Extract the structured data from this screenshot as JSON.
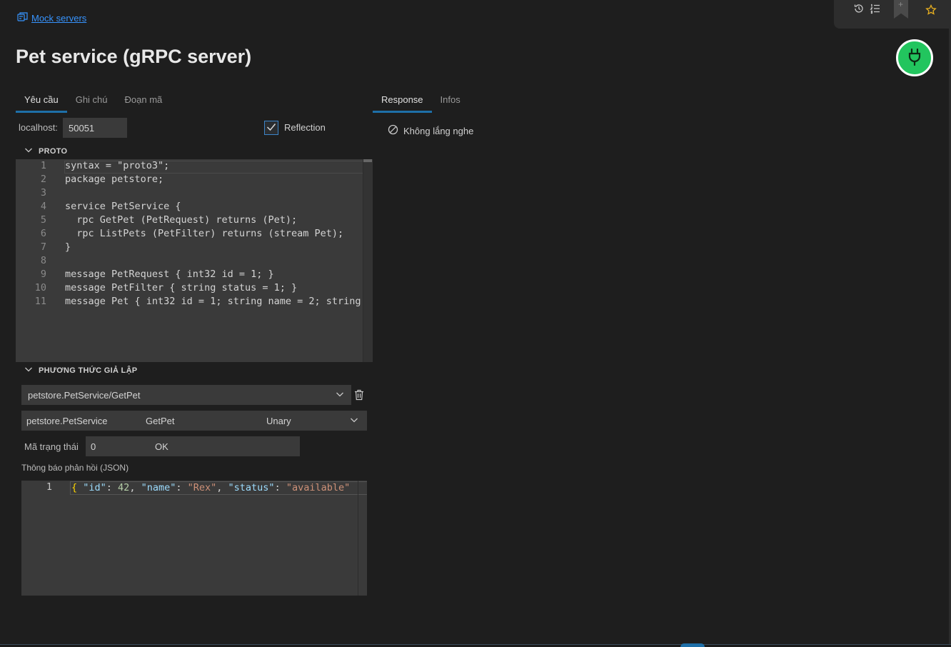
{
  "breadcrumb": {
    "label": "Mock servers",
    "icon": "mock-server-icon"
  },
  "page_title": "Pet service (gRPC server)",
  "toolbar": {
    "icons": [
      "history-icon",
      "list-ordered-icon",
      "bookmark-icon",
      "star-icon"
    ]
  },
  "power_button": {
    "color": "#22c55e",
    "icon": "plug-icon"
  },
  "left_tabs": [
    {
      "label": "Yêu cầu",
      "active": true
    },
    {
      "label": "Ghi chú",
      "active": false
    },
    {
      "label": "Đoạn mã",
      "active": false
    }
  ],
  "right_tabs": [
    {
      "label": "Response",
      "active": true
    },
    {
      "label": "Infos",
      "active": false
    }
  ],
  "host": {
    "label": "localhost:",
    "port": "50051"
  },
  "reflection": {
    "label": "Reflection",
    "checked": true
  },
  "proto_section": {
    "title": "PROTO"
  },
  "proto_code": [
    {
      "n": "1",
      "text": "syntax = \"proto3\";"
    },
    {
      "n": "2",
      "text": "package petstore;"
    },
    {
      "n": "3",
      "text": ""
    },
    {
      "n": "4",
      "text": "service PetService {"
    },
    {
      "n": "5",
      "text": "  rpc GetPet (PetRequest) returns (Pet);"
    },
    {
      "n": "6",
      "text": "  rpc ListPets (PetFilter) returns (stream Pet);"
    },
    {
      "n": "7",
      "text": "}"
    },
    {
      "n": "8",
      "text": ""
    },
    {
      "n": "9",
      "text": "message PetRequest { int32 id = 1; }"
    },
    {
      "n": "10",
      "text": "message PetFilter { string status = 1; }"
    },
    {
      "n": "11",
      "text": "message Pet { int32 id = 1; string name = 2; string"
    }
  ],
  "methods_section": {
    "title": "PHƯƠNG THỨC GIẢ LẬP"
  },
  "method_select": {
    "value": "petstore.PetService/GetPet"
  },
  "method_detail": {
    "service": "petstore.PetService",
    "method": "GetPet",
    "type": "Unary"
  },
  "status_code": {
    "label": "Mã trạng thái",
    "code": "0",
    "text": "OK"
  },
  "response_message": {
    "label": "Thông báo phản hồi (JSON)",
    "line_number": "1",
    "tokens": [
      {
        "t": "{ ",
        "c": "j-brace"
      },
      {
        "t": "\"id\"",
        "c": "j-key"
      },
      {
        "t": ": ",
        "c": "j-punc"
      },
      {
        "t": "42",
        "c": "j-num"
      },
      {
        "t": ", ",
        "c": "j-punc"
      },
      {
        "t": "\"name\"",
        "c": "j-key"
      },
      {
        "t": ": ",
        "c": "j-punc"
      },
      {
        "t": "\"Rex\"",
        "c": "j-str"
      },
      {
        "t": ", ",
        "c": "j-punc"
      },
      {
        "t": "\"status\"",
        "c": "j-key"
      },
      {
        "t": ": ",
        "c": "j-punc"
      },
      {
        "t": "\"available\"",
        "c": "j-str"
      }
    ]
  },
  "response_panel": {
    "status_text": "Không lắng nghe",
    "icon": "ban-icon"
  }
}
